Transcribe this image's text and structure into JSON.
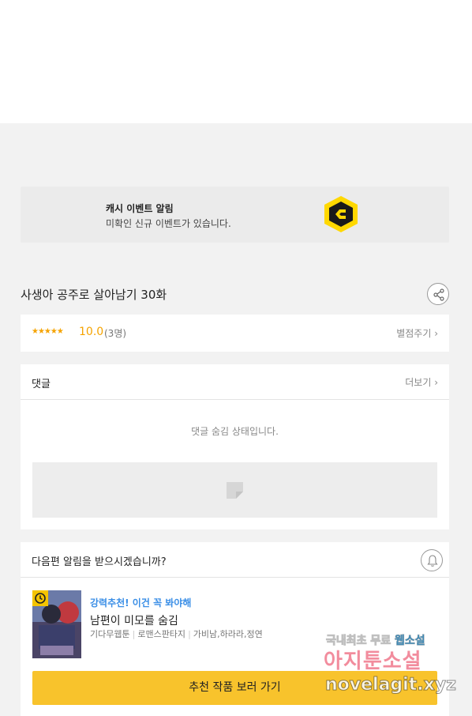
{
  "cash_event": {
    "title": "캐시 이벤트 알림",
    "description": "미확인 신규 이벤트가 있습니다."
  },
  "episode": {
    "title": "사생아 공주로 살아남기 30화"
  },
  "rating": {
    "stars": "★★★★★",
    "value": "10.0",
    "count": "(3명)",
    "rate_link": "별점주기 ›"
  },
  "comments": {
    "label": "댓글",
    "more_link": "더보기 ›",
    "hidden_message": "댓글 숨김 상태입니다."
  },
  "notify": {
    "question": "다음편 알림을 받으시겠습니까?"
  },
  "recommendation": {
    "tag": "강력추천! 이건 꼭 봐야해",
    "title": "남편이 미모를 숨김",
    "genres": [
      "기다무웹툰",
      "로맨스판타지",
      "가비남,하라라,정연"
    ],
    "button_label": "추천 작품 보러 가기"
  },
  "watermark": {
    "line1_prefix": "국내최초 무료 ",
    "line1_highlight": "웹소설",
    "line2": "아지툰소설",
    "line3": "novelagit.xyz"
  },
  "colors": {
    "accent_yellow": "#f8c32c",
    "rating_orange": "#f5a300",
    "tag_blue": "#3a8ee6"
  }
}
